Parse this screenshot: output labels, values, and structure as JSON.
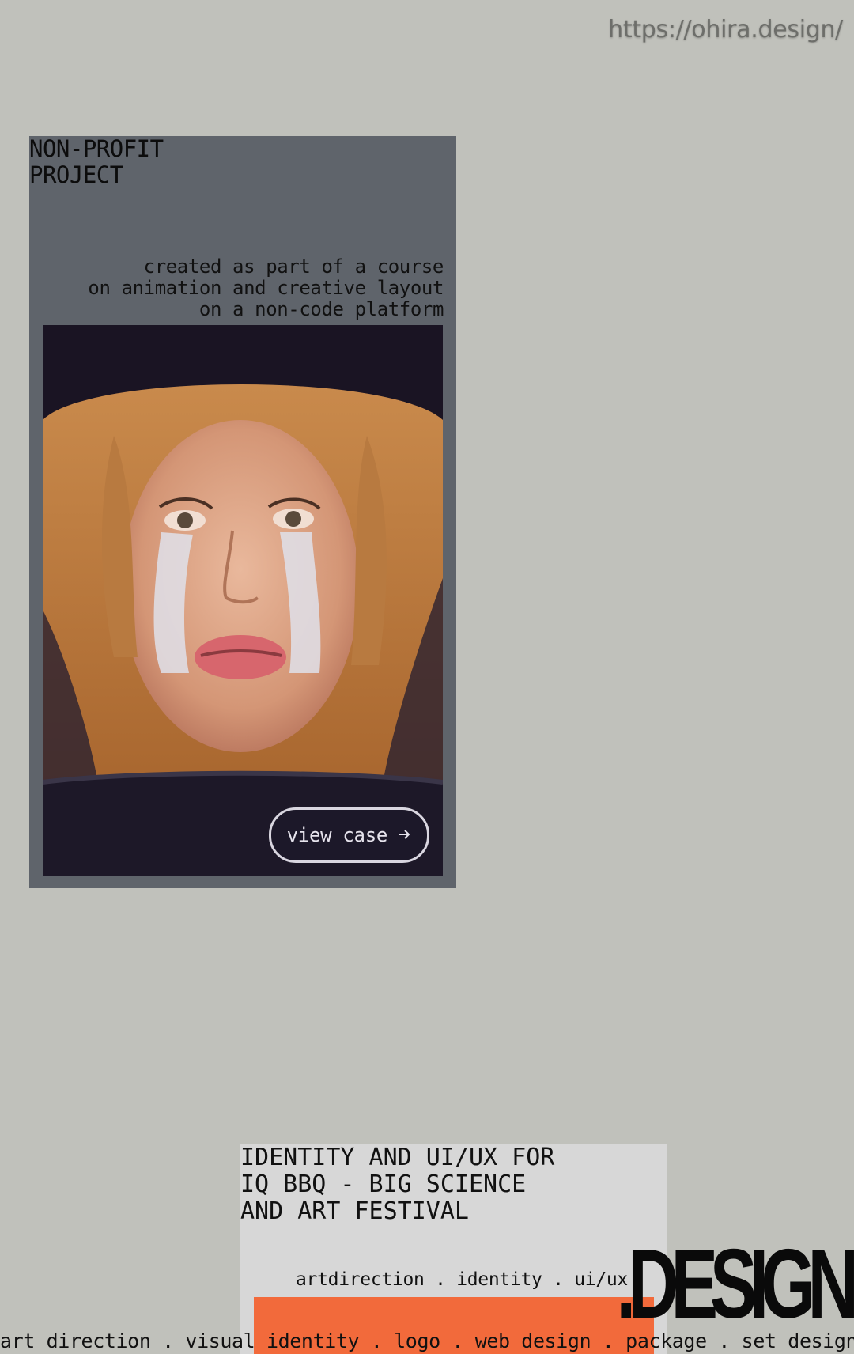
{
  "browser": {
    "url": "https://ohira.design/"
  },
  "projects": [
    {
      "title": "NON-PROFIT\nPROJECT",
      "description": "created as part of a course\non animation and creative layout\non a non-code platform",
      "cta_label": "view case",
      "cta_icon": "arrow-right-icon"
    },
    {
      "title": "IDENTITY AND UI/UX FOR\nIQ BBQ - BIG SCIENCE\nAND ART FESTIVAL",
      "tags": "artdirection . identity . ui/ux"
    }
  ],
  "brand": {
    "wordmark": ".DESIGN"
  },
  "services_marquee": "art direction . visual identity . logo . web design . package . set design",
  "colors": {
    "page_background": "#c0c1bb",
    "card_dark": "#5f646b",
    "card_light": "#d7d7d7",
    "accent_orange": "#f26a3b"
  }
}
